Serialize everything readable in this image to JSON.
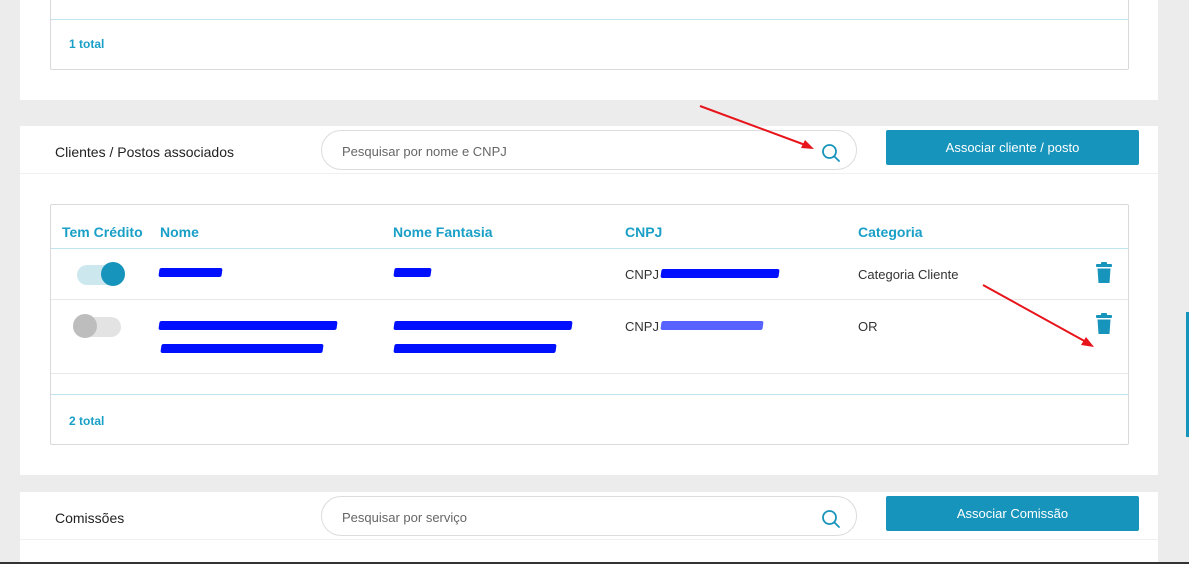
{
  "top_section": {
    "total": "1 total"
  },
  "clients": {
    "title": "Clientes / Postos associados",
    "search_placeholder": "Pesquisar por nome e CNPJ",
    "button": "Associar cliente / posto",
    "headers": {
      "credito": "Tem Crédito",
      "nome": "Nome",
      "fantasia": "Nome Fantasia",
      "cnpj": "CNPJ",
      "categoria": "Categoria"
    },
    "rows": [
      {
        "tem_credito": true,
        "cnpj_prefix": "CNPJ",
        "categoria": "Categoria Cliente"
      },
      {
        "tem_credito": false,
        "cnpj_prefix": "CNPJ",
        "categoria": "OR"
      }
    ],
    "total": "2 total"
  },
  "commissions": {
    "title": "Comissões",
    "search_placeholder": "Pesquisar por serviço",
    "button": "Associar Comissão"
  },
  "colors": {
    "accent": "#1794bb",
    "header_text": "#1a9fc7",
    "redaction": "#0010ff",
    "annotation_arrow": "#e8141b"
  },
  "icons": [
    "search-icon",
    "trash-icon"
  ]
}
